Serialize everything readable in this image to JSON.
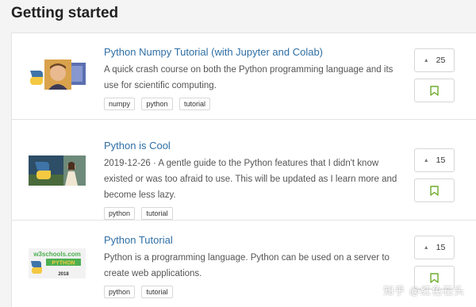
{
  "section": {
    "title": "Getting started"
  },
  "accent_color": "#2f6fa5",
  "bookmark_color": "#6cab2b",
  "cards": [
    {
      "title": "Python Numpy Tutorial (with Jupyter and Colab)",
      "description": "A quick crash course on both the Python programming language and its use for scientific computing.",
      "tags": [
        "numpy",
        "python",
        "tutorial"
      ],
      "votes": "25",
      "vote_icon": "caret-up-icon",
      "save_icon": "bookmark-icon"
    },
    {
      "title": "Python is Cool",
      "description": "2019-12-26 · A gentle guide to the Python features that I didn't know existed or was too afraid to use. This will be updated as I learn more and become less lazy.",
      "tags": [
        "python",
        "tutorial"
      ],
      "votes": "15",
      "vote_icon": "caret-up-icon",
      "save_icon": "bookmark-icon"
    },
    {
      "title": "Python Tutorial",
      "description": "Python is a programming language. Python can be used on a server to create web applications.",
      "tags": [
        "python",
        "tutorial"
      ],
      "votes": "15",
      "vote_icon": "caret-up-icon",
      "save_icon": "bookmark-icon",
      "thumbnail_text": {
        "site": "w3schools.com",
        "lang": "PYTHON",
        "year": "2018"
      }
    }
  ],
  "watermark": "知乎 @红色石头"
}
